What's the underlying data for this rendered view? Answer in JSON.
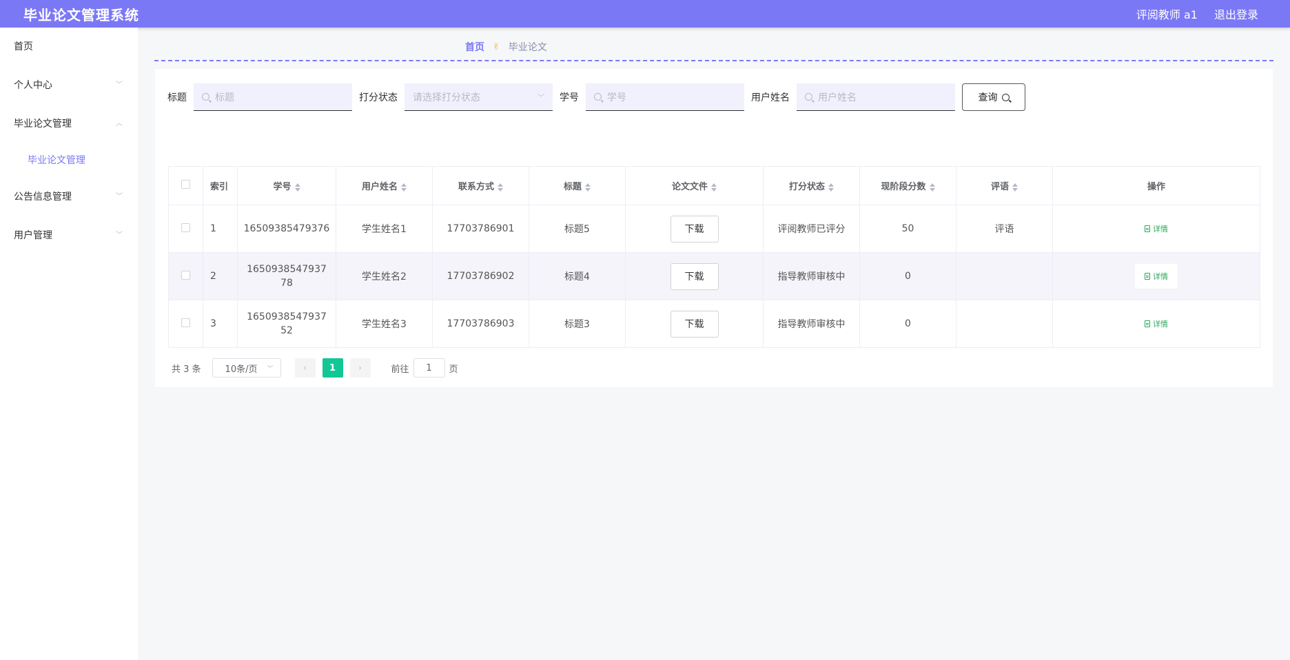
{
  "header": {
    "app_title": "毕业论文管理系统",
    "user_role": "评阅教师 a1",
    "logout": "退出登录",
    "color": "#7b78f6"
  },
  "sidebar": {
    "items": [
      {
        "label": "首页",
        "icon": "none"
      },
      {
        "label": "个人中心",
        "icon": "chevron-down-icon"
      },
      {
        "label": "毕业论文管理",
        "icon": "chevron-up-icon"
      },
      {
        "label": "毕业论文管理",
        "sub": true
      },
      {
        "label": "公告信息管理",
        "icon": "chevron-down-icon"
      },
      {
        "label": "用户管理",
        "icon": "chevron-down-icon"
      }
    ]
  },
  "breadcrumb": {
    "home": "首页",
    "separator_icon": "hand-icon",
    "current": "毕业论文"
  },
  "search": {
    "title_label": "标题",
    "title_placeholder": "标题",
    "status_label": "打分状态",
    "status_placeholder": "请选择打分状态",
    "student_no_label": "学号",
    "student_no_placeholder": "学号",
    "username_label": "用户姓名",
    "username_placeholder": "用户姓名",
    "query_button": "查询"
  },
  "table": {
    "columns": [
      "索引",
      "学号",
      "用户姓名",
      "联系方式",
      "标题",
      "论文文件",
      "打分状态",
      "现阶段分数",
      "评语",
      "操作"
    ],
    "rows": [
      {
        "index": "1",
        "student_no": "16509385479376",
        "name": "学生姓名1",
        "phone": "17703786901",
        "title": "标题5",
        "file": "下载",
        "status": "评阅教师已评分",
        "score": "50",
        "comment": "评语",
        "action": "详情"
      },
      {
        "index": "2",
        "student_no": "165093854793778",
        "name": "学生姓名2",
        "phone": "17703786902",
        "title": "标题4",
        "file": "下载",
        "status": "指导教师审核中",
        "score": "0",
        "comment": "",
        "action": "详情"
      },
      {
        "index": "3",
        "student_no": "165093854793752",
        "name": "学生姓名3",
        "phone": "17703786903",
        "title": "标题3",
        "file": "下载",
        "status": "指导教师审核中",
        "score": "0",
        "comment": "",
        "action": "详情"
      }
    ]
  },
  "pagination": {
    "total": "共 3 条",
    "page_size": "10条/页",
    "current_page": "1",
    "goto_prefix": "前往",
    "goto_value": "1",
    "goto_suffix": "页"
  },
  "colors": {
    "accent": "#7b78f6",
    "active_page": "#13c795",
    "detail_link": "#27a85a"
  }
}
